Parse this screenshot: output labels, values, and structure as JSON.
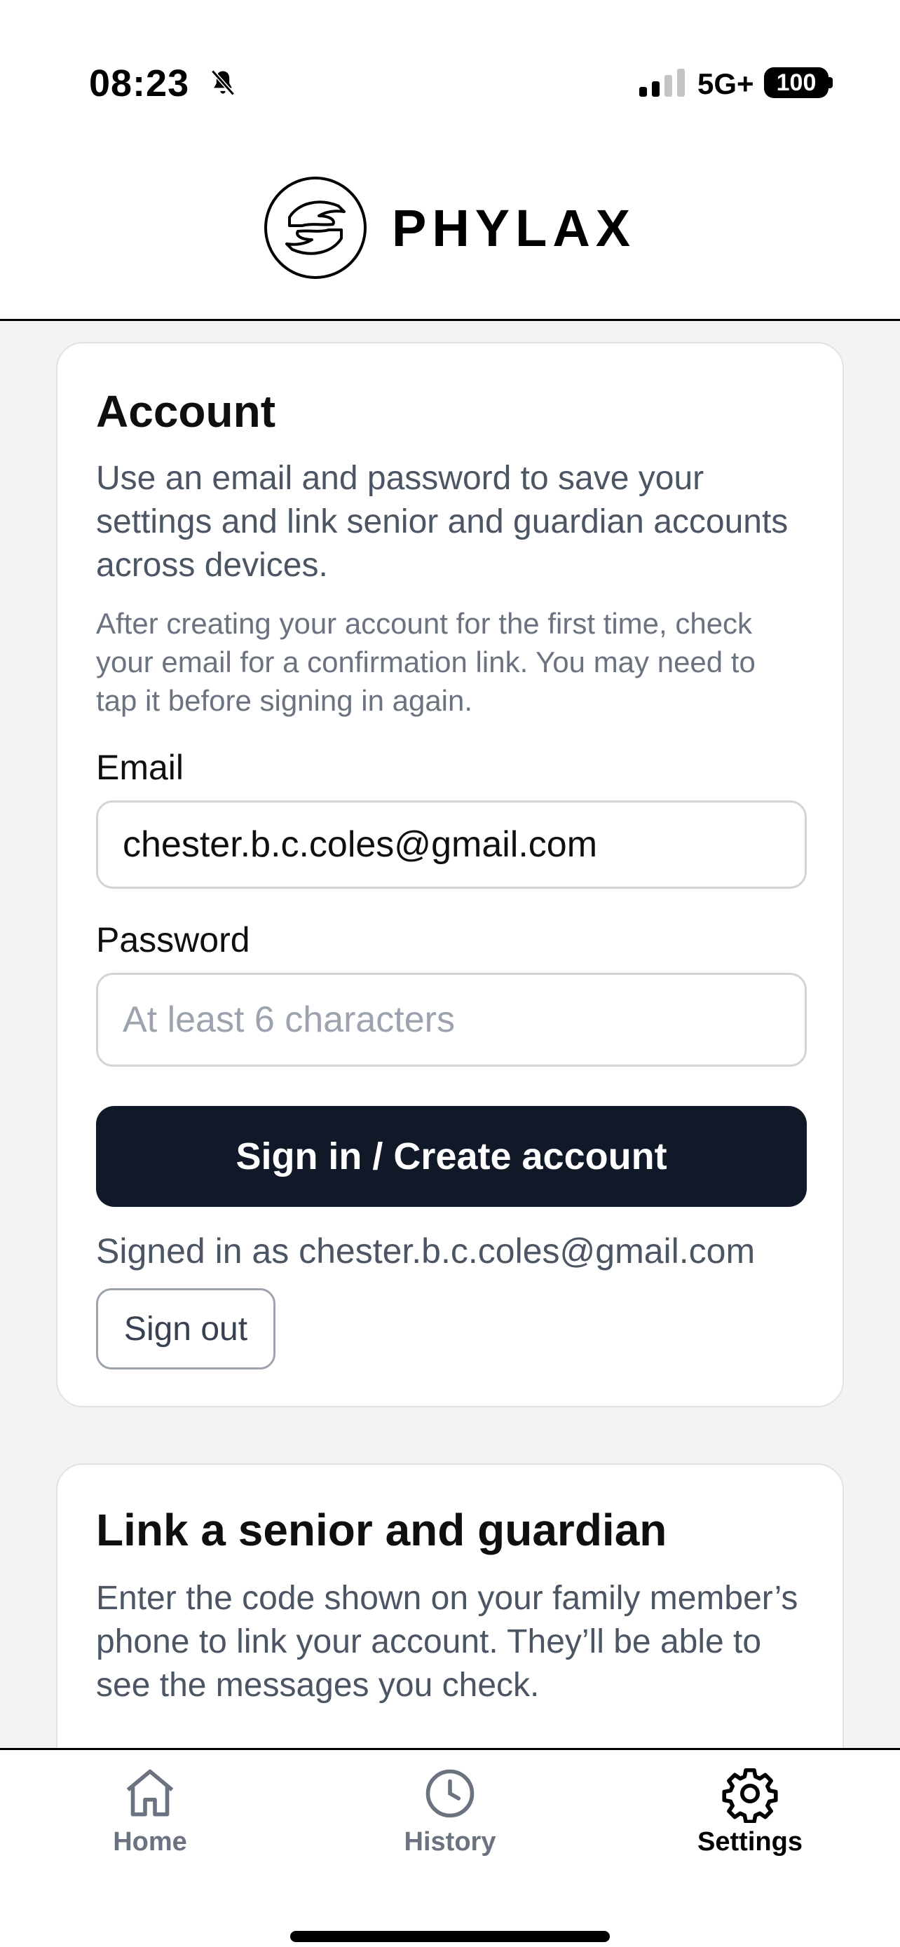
{
  "status_bar": {
    "time": "08:23",
    "network": "5G+",
    "battery": "100"
  },
  "header": {
    "app_name": "PHYLAX"
  },
  "account_card": {
    "title": "Account",
    "description": "Use an email and password to save your settings and link senior and guardian accounts across devices.",
    "note": "After creating your account for the first time, check your email for a confirmation link. You may need to tap it before signing in again.",
    "email_label": "Email",
    "email_value": "chester.b.c.coles@gmail.com",
    "password_label": "Password",
    "password_placeholder": "At least 6 characters",
    "submit_label": "Sign in / Create account",
    "signed_in_text": "Signed in as chester.b.c.coles@gmail.com",
    "sign_out_label": "Sign out"
  },
  "link_card": {
    "title": "Link a senior and guardian",
    "description": "Enter the code shown on your family member’s phone to link your account. They’ll be able to see the messages you check."
  },
  "tabbar": {
    "tabs": [
      {
        "label": "Home",
        "icon": "home-icon",
        "active": false
      },
      {
        "label": "History",
        "icon": "clock-icon",
        "active": false
      },
      {
        "label": "Settings",
        "icon": "gear-icon",
        "active": true
      }
    ]
  },
  "colors": {
    "primary_button": "#111827",
    "background": "#f3f3f3",
    "muted_text": "#4b5563"
  }
}
